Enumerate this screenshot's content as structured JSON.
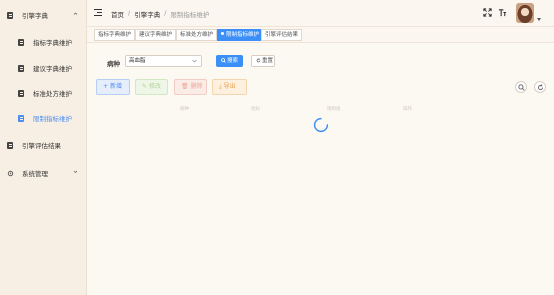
{
  "sidebar": {
    "items": [
      {
        "label": "引擎字典",
        "icon": "document-icon",
        "level": "top",
        "expanded": true
      },
      {
        "label": "指标字典维护",
        "icon": "document-icon",
        "level": "sub"
      },
      {
        "label": "建议字典维护",
        "icon": "document-icon",
        "level": "sub"
      },
      {
        "label": "标准处方维护",
        "icon": "document-icon",
        "level": "sub"
      },
      {
        "label": "限制指标维护",
        "icon": "document-icon",
        "level": "sub",
        "active": true
      },
      {
        "label": "引擎评估结果",
        "icon": "document-icon",
        "level": "top"
      },
      {
        "label": "系统管理",
        "icon": "gear-icon",
        "level": "top",
        "expanded": false
      }
    ]
  },
  "header": {
    "breadcrumb": [
      "首页",
      "引擎字典",
      "限制指标维护"
    ],
    "icons": [
      "fullscreen-icon",
      "font-size-icon"
    ],
    "avatar": "user-avatar"
  },
  "tags": [
    {
      "label": "指标字典维护"
    },
    {
      "label": "建议字典维护"
    },
    {
      "label": "标准处方维护"
    },
    {
      "label": "限制指标维护",
      "active": true
    },
    {
      "label": "引擎评估结果"
    }
  ],
  "search": {
    "label": "病种",
    "selected": "高血脂",
    "search_button": "搜索",
    "reset_button": "重置"
  },
  "actions": {
    "add": "新增",
    "edit": "修改",
    "delete": "删除",
    "export": "导出"
  },
  "table": {
    "columns": [
      "病种",
      "指标",
      "限制值",
      "操作"
    ]
  },
  "colors": {
    "accent": "#3b8ff6",
    "sidebar_bg": "#f8efe4",
    "page_bg": "#fbf6ef"
  },
  "loading": true
}
